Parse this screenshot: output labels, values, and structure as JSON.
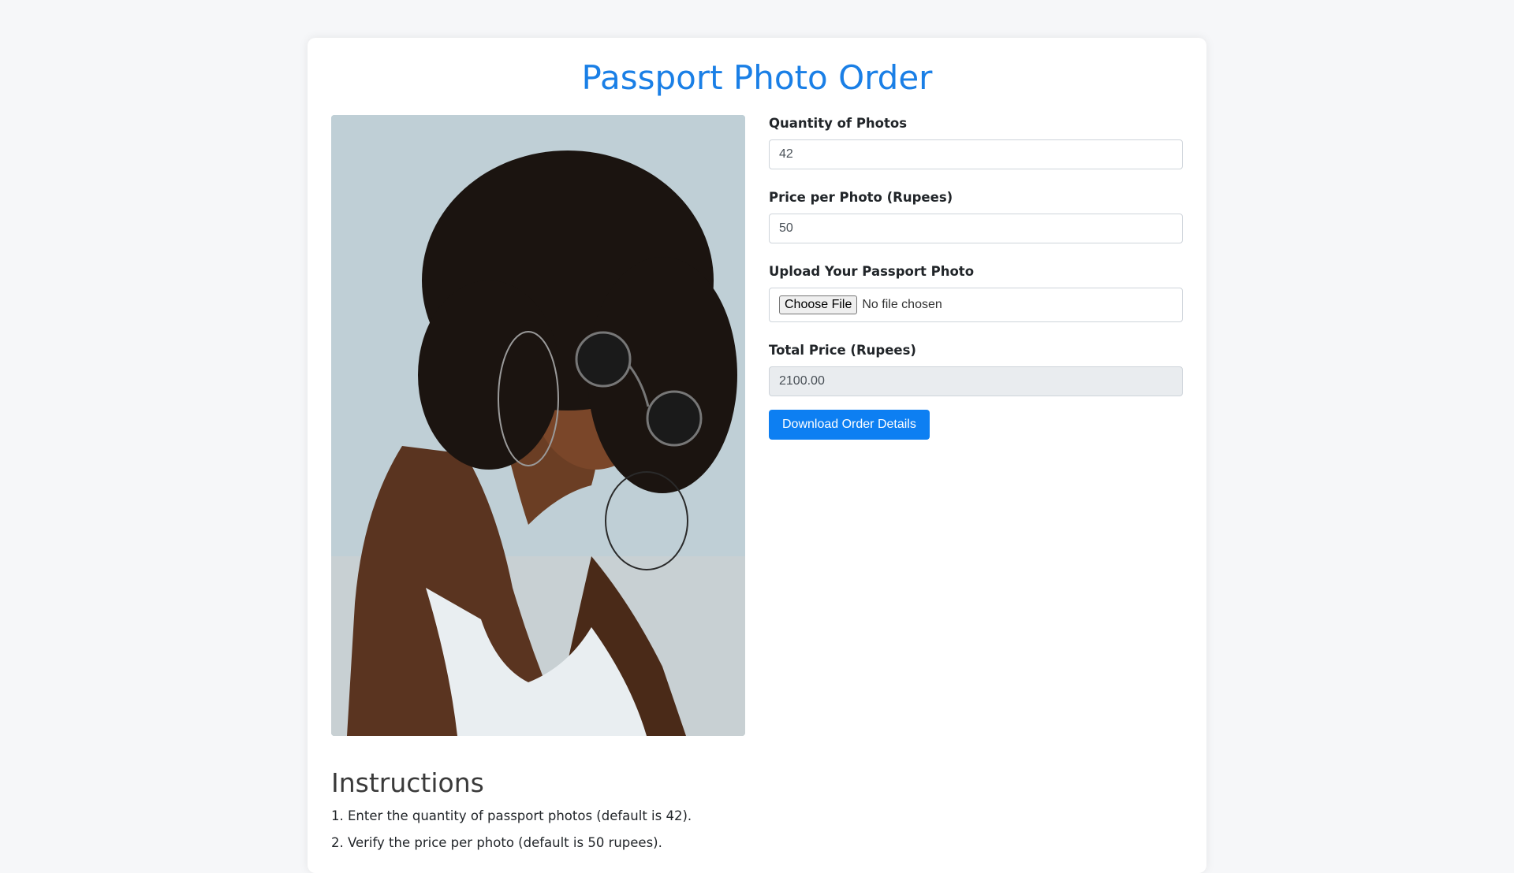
{
  "header": {
    "title": "Passport Photo Order"
  },
  "form": {
    "quantity_label": "Quantity of Photos",
    "quantity_value": "42",
    "price_label": "Price per Photo (Rupees)",
    "price_value": "50",
    "upload_label": "Upload Your Passport Photo",
    "choose_file_label": "Choose File",
    "file_status": "No file chosen",
    "total_label": "Total Price (Rupees)",
    "total_value": "2100.00",
    "download_label": "Download Order Details"
  },
  "instructions": {
    "heading": "Instructions",
    "steps": [
      "1. Enter the quantity of passport photos (default is 42).",
      "2. Verify the price per photo (default is 50 rupees)."
    ]
  },
  "colors": {
    "accent": "#1a7fe6",
    "button": "#0d7ff2"
  }
}
